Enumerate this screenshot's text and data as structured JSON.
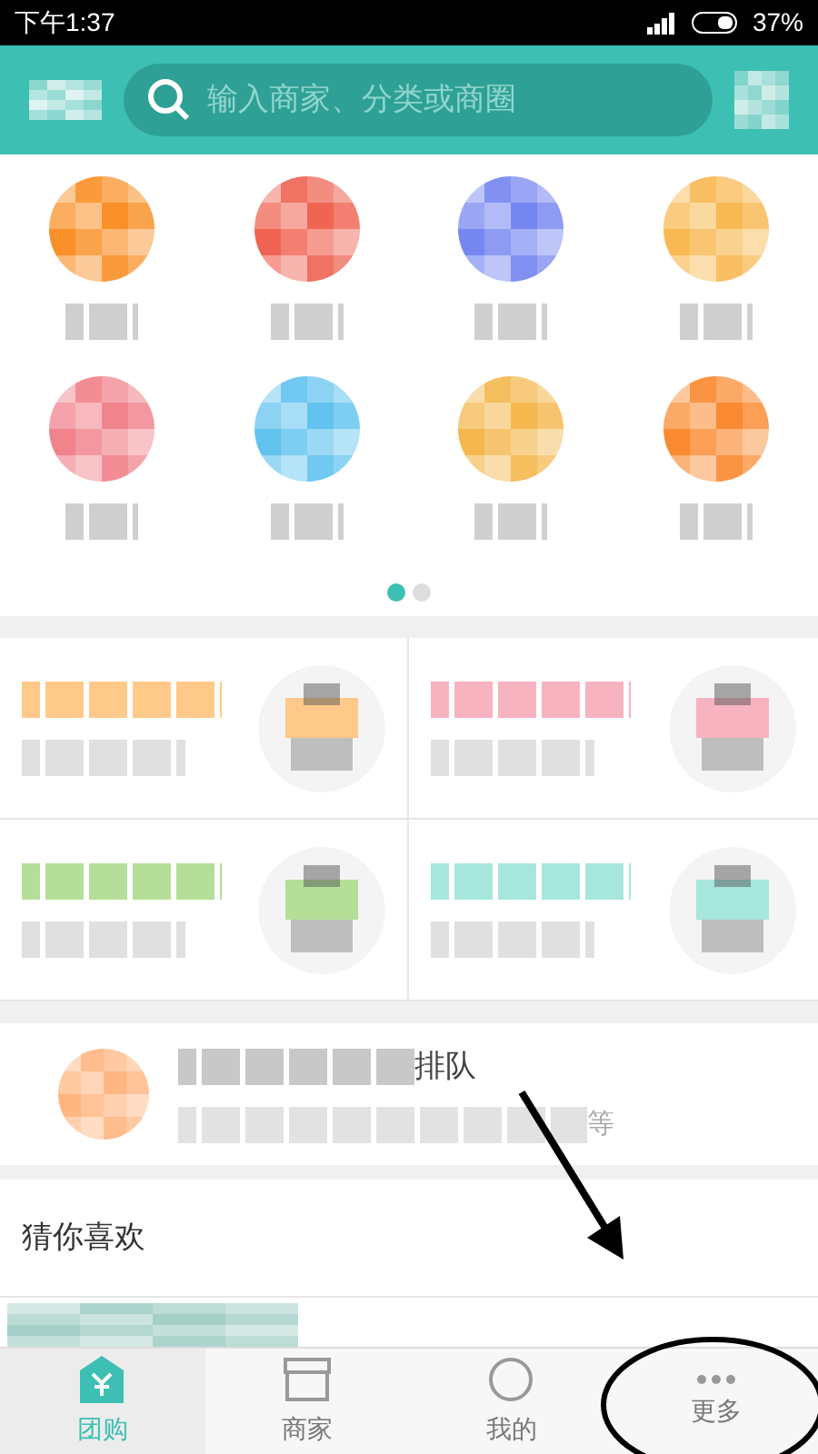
{
  "status_bar": {
    "time": "下午1:37",
    "battery": "37%"
  },
  "header": {
    "search_placeholder": "输入商家、分类或商圈"
  },
  "categories": [
    {
      "color": "#f98a1c"
    },
    {
      "color": "#ee5c4a"
    },
    {
      "color": "#6f7ff0"
    },
    {
      "color": "#f8b54a"
    },
    {
      "color": "#f07c86"
    },
    {
      "color": "#5bc0ee"
    },
    {
      "color": "#f4b446"
    },
    {
      "color": "#f98426"
    }
  ],
  "page_dots": [
    {
      "selected": true
    },
    {
      "selected": false
    }
  ],
  "promos": [
    {
      "color": "#ffc98a"
    },
    {
      "color": "#f7b3c0"
    },
    {
      "color": "#b5df98"
    },
    {
      "color": "#a6e6dc"
    }
  ],
  "queue": {
    "title_end": "排队",
    "subtitle_end": "等"
  },
  "section_title": "猜你喜欢",
  "tabs": [
    {
      "label": "团购",
      "selected": true,
      "kind": "tag"
    },
    {
      "label": "商家",
      "selected": false,
      "kind": "shop"
    },
    {
      "label": "我的",
      "selected": false,
      "kind": "user"
    },
    {
      "label": "更多",
      "selected": false,
      "kind": "more"
    }
  ]
}
